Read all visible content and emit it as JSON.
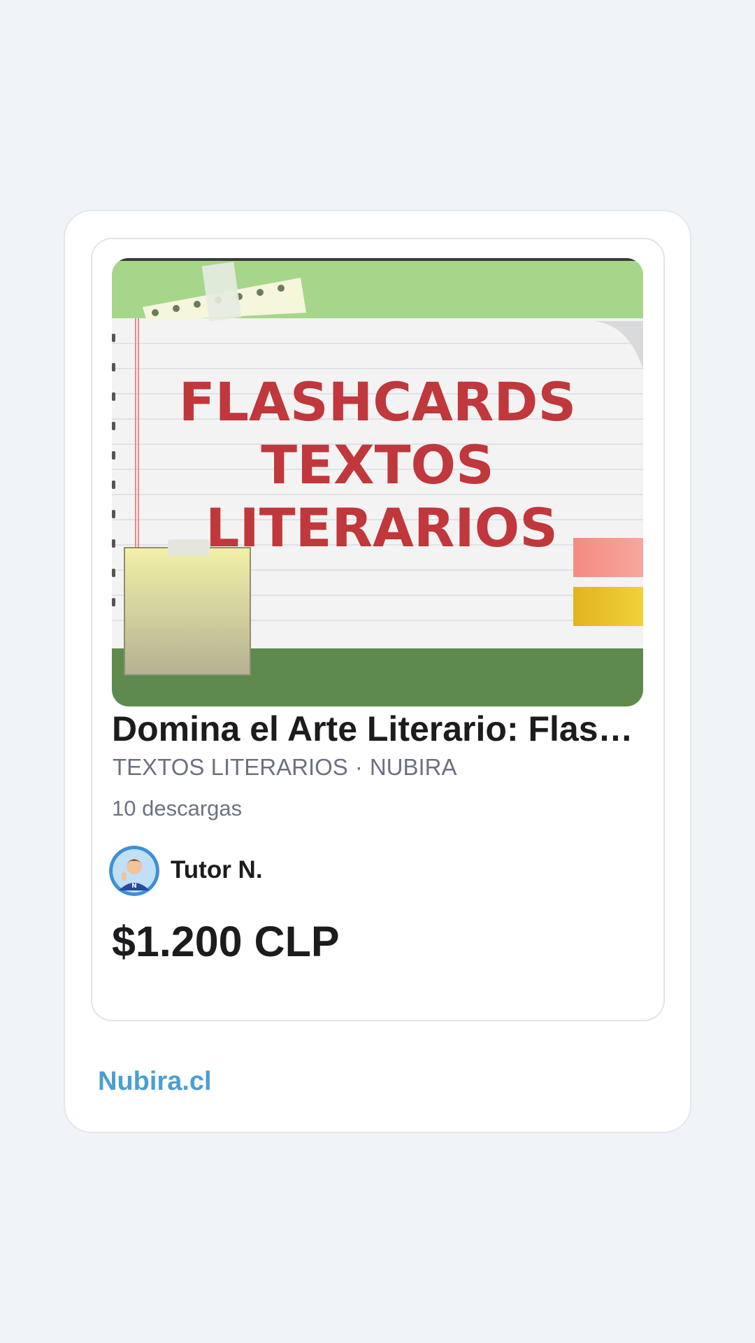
{
  "product": {
    "thumbnail_lines": [
      "FLASHCARDS",
      "TEXTOS",
      "LITERARIOS"
    ],
    "title": "Domina el Arte Literario: Flashcards Textos Literarios",
    "category": "TEXTOS LITERARIOS",
    "separator": "·",
    "brand": "NUBIRA",
    "downloads": "10 descargas",
    "author": "Tutor N.",
    "avatar_icon": "tutor-avatar-icon",
    "price": "$1.200 CLP"
  },
  "footer": {
    "site_link": "Nubira.cl"
  },
  "colors": {
    "background": "#f0f4f8",
    "card": "#ffffff",
    "accent_link": "#4a9fd4",
    "thumbnail_title": "#c0373c"
  }
}
